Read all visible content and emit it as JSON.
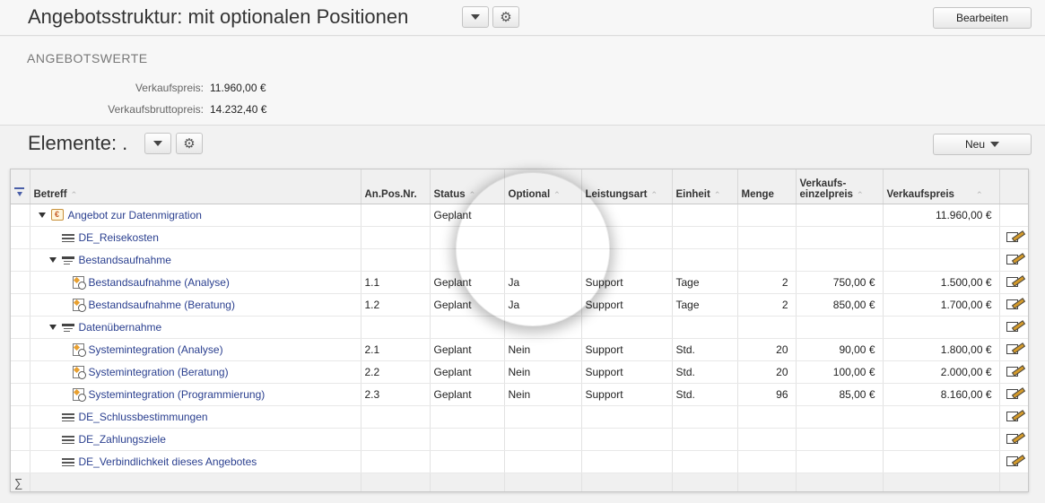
{
  "header": {
    "title": "Angebotsstruktur: mit optionalen Positionen",
    "edit_button": "Bearbeiten"
  },
  "offer_values": {
    "heading": "ANGEBOTSWERTE",
    "items": [
      {
        "label": "Verkaufspreis:",
        "value": "11.960,00 €"
      },
      {
        "label": "Verkaufsbruttopreis:",
        "value": "14.232,40 €"
      }
    ]
  },
  "elements": {
    "title": "Elemente: .",
    "new_button": "Neu"
  },
  "table": {
    "columns": [
      "Betreff",
      "An.Pos.Nr.",
      "Status",
      "Optional",
      "Leistungsart",
      "Einheit",
      "Menge",
      "Verkaufs-\neinzelpreis",
      "Verkaufspreis"
    ],
    "col_verkaufs_line1": "Verkaufs-",
    "col_verkaufs_line2": "einzelpreis",
    "rows": [
      {
        "betreff": "Angebot zur Datenmigration",
        "pos": "",
        "status": "Geplant",
        "optional": "",
        "art": "",
        "einheit": "",
        "menge": "",
        "ep": "",
        "vp": "11.960,00 €"
      },
      {
        "betreff": "DE_Reisekosten",
        "pos": "",
        "status": "",
        "optional": "",
        "art": "",
        "einheit": "",
        "menge": "",
        "ep": "",
        "vp": ""
      },
      {
        "betreff": "Bestandsaufnahme",
        "pos": "",
        "status": "",
        "optional": "",
        "art": "",
        "einheit": "",
        "menge": "",
        "ep": "",
        "vp": ""
      },
      {
        "betreff": "Bestandsaufnahme (Analyse)",
        "pos": "1.1",
        "status": "Geplant",
        "optional": "Ja",
        "art": "Support",
        "einheit": "Tage",
        "menge": "2",
        "ep": "750,00 €",
        "vp": "1.500,00 €"
      },
      {
        "betreff": "Bestandsaufnahme (Beratung)",
        "pos": "1.2",
        "status": "Geplant",
        "optional": "Ja",
        "art": "Support",
        "einheit": "Tage",
        "menge": "2",
        "ep": "850,00 €",
        "vp": "1.700,00 €"
      },
      {
        "betreff": "Datenübernahme",
        "pos": "",
        "status": "",
        "optional": "",
        "art": "",
        "einheit": "",
        "menge": "",
        "ep": "",
        "vp": ""
      },
      {
        "betreff": "Systemintegration (Analyse)",
        "pos": "2.1",
        "status": "Geplant",
        "optional": "Nein",
        "art": "Support",
        "einheit": "Std.",
        "menge": "20",
        "ep": "90,00 €",
        "vp": "1.800,00 €"
      },
      {
        "betreff": "Systemintegration (Beratung)",
        "pos": "2.2",
        "status": "Geplant",
        "optional": "Nein",
        "art": "Support",
        "einheit": "Std.",
        "menge": "20",
        "ep": "100,00 €",
        "vp": "2.000,00 €"
      },
      {
        "betreff": "Systemintegration (Programmierung)",
        "pos": "2.3",
        "status": "Geplant",
        "optional": "Nein",
        "art": "Support",
        "einheit": "Std.",
        "menge": "96",
        "ep": "85,00 €",
        "vp": "8.160,00 €"
      },
      {
        "betreff": "DE_Schlussbestimmungen",
        "pos": "",
        "status": "",
        "optional": "",
        "art": "",
        "einheit": "",
        "menge": "",
        "ep": "",
        "vp": ""
      },
      {
        "betreff": "DE_Zahlungsziele",
        "pos": "",
        "status": "",
        "optional": "",
        "art": "",
        "einheit": "",
        "menge": "",
        "ep": "",
        "vp": ""
      },
      {
        "betreff": "DE_Verbindlichkeit dieses Angebotes",
        "pos": "",
        "status": "",
        "optional": "",
        "art": "",
        "einheit": "",
        "menge": "",
        "ep": "",
        "vp": ""
      }
    ],
    "sum_symbol": "∑"
  },
  "icons": {
    "dropdown": "chevron-down-icon",
    "settings": "gear-icon",
    "edit": "edit-icon",
    "offer": "offer-icon",
    "text_block": "text-block-icon",
    "group": "group-icon",
    "position": "position-icon"
  }
}
